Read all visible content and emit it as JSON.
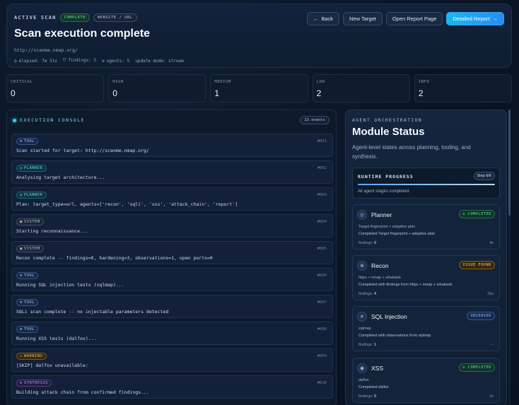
{
  "header": {
    "eyebrow": "ACTIVE SCAN",
    "status_badge": "COMPLETE",
    "kind_badge": "WEBSITE / URL",
    "title": "Scan execution complete",
    "target": "http://scanme.nmap.org/",
    "meta": {
      "elapsed": "elapsed: 7m 51s",
      "findings": "findings: 5",
      "agents": "agents: 5",
      "mode": "update mode: stream"
    },
    "actions": {
      "back": "Back",
      "new_target": "New Target",
      "open_report": "Open Report Page",
      "detailed_report": "Detailed Report"
    }
  },
  "severity": [
    {
      "label": "CRITICAL",
      "value": "0"
    },
    {
      "label": "HIGH",
      "value": "0"
    },
    {
      "label": "MEDIUM",
      "value": "1"
    },
    {
      "label": "LOW",
      "value": "2"
    },
    {
      "label": "INFO",
      "value": "2"
    }
  ],
  "console": {
    "title": "EXECUTION CONSOLE",
    "events": "13 events",
    "entries": [
      {
        "tag": "TOOL",
        "seq": "#001",
        "msg": "Scan started for target: http://scanme.nmap.org/"
      },
      {
        "tag": "PLANNER",
        "seq": "#002",
        "msg": "Analysing target architecture..."
      },
      {
        "tag": "PLANNER",
        "seq": "#003",
        "msg": "Plan: target_type=url, agents=['recon', 'sqli', 'xss', 'attack_chain', 'report']"
      },
      {
        "tag": "SYSTEM",
        "seq": "#004",
        "msg": "Starting reconnaissance..."
      },
      {
        "tag": "SYSTEM",
        "seq": "#005",
        "msg": "Recon complete -- findings=0, hardening=3, observations=1, open ports=0"
      },
      {
        "tag": "TOOL",
        "seq": "#006",
        "msg": "Running SQL injection tests (sqlmap)..."
      },
      {
        "tag": "TOOL",
        "seq": "#007",
        "msg": "SQLi scan complete -- no injectable parameters detected"
      },
      {
        "tag": "TOOL",
        "seq": "#008",
        "msg": "Running XSS tests (dalfox)..."
      },
      {
        "tag": "WARNING",
        "seq": "#009",
        "msg": "[SKIP] dalfox unavailable:"
      },
      {
        "tag": "SYNTHESIS",
        "seq": "#010",
        "msg": "Building attack chain from confirmed findings..."
      }
    ]
  },
  "orchestration": {
    "eyebrow": "AGENT ORCHESTRATION",
    "title": "Module Status",
    "description": "Agent-level states across planning, tooling, and synthesis.",
    "runtime": {
      "label": "RUNTIME PROGRESS",
      "step": "Step 6/6",
      "progress": 1.0,
      "note": "All agent stages completed."
    },
    "modules": [
      {
        "name": "Planner",
        "icon": "planner-icon",
        "badge": "COMPLETED",
        "tools": "Target fingerprint + adaptive plan",
        "detail": "Completed Target fingerprint + adaptive plan",
        "findings_label": "findings:",
        "findings": "0",
        "time": "4s"
      },
      {
        "name": "Recon",
        "icon": "globe-icon",
        "badge": "ISSUE FOUND",
        "tools": "httpx + nmap + whatweb",
        "detail": "Completed with findings from httpx + nmap + whatweb",
        "findings_label": "findings:",
        "findings": "4",
        "time": "15s"
      },
      {
        "name": "SQL Injection",
        "icon": "database-icon",
        "badge": "OBSERVED",
        "tools": "sqlmap",
        "detail": "Completed with observations from sqlmap",
        "findings_label": "findings:",
        "findings": "1",
        "time": "--"
      },
      {
        "name": "XSS",
        "icon": "code-icon",
        "badge": "COMPLETED",
        "tools": "dalfox",
        "detail": "Completed dalfox",
        "findings_label": "findings:",
        "findings": "0",
        "time": "3s"
      }
    ]
  }
}
